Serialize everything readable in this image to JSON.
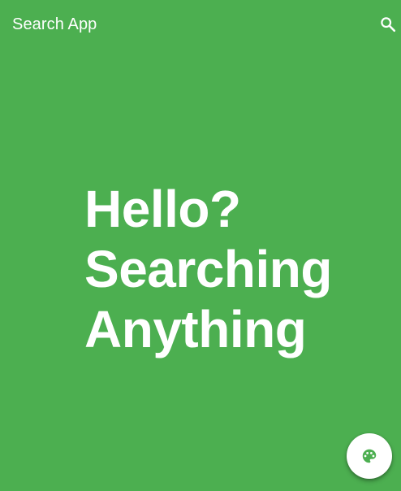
{
  "app_bar": {
    "title": "Search App",
    "search_icon": "search-icon"
  },
  "headline": {
    "lines": [
      "Hello?",
      "Searching",
      "Anything"
    ]
  },
  "fab": {
    "icon": "palette-icon"
  },
  "colors": {
    "background": "#4caf50",
    "text": "#ffffff",
    "fab_background": "#ffffff",
    "fab_icon": "#4caf50"
  }
}
